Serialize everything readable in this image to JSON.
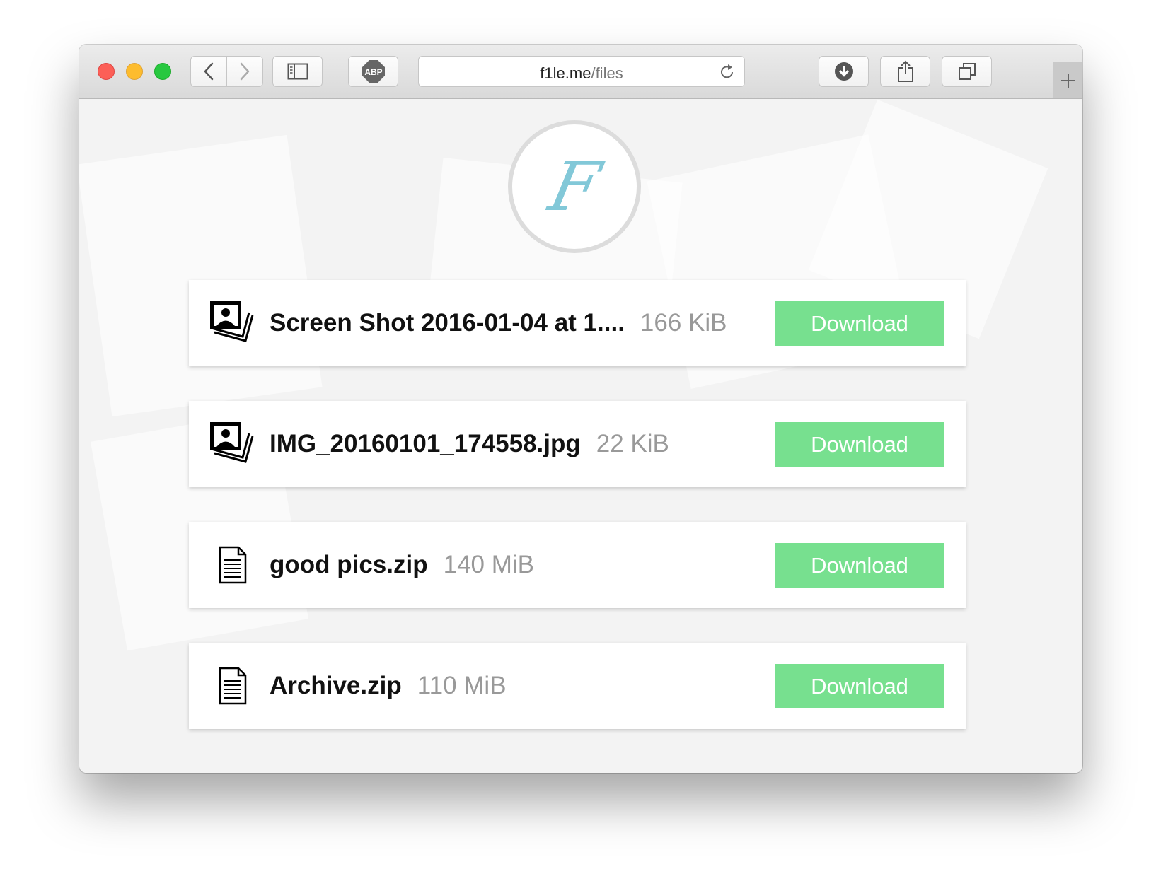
{
  "browser": {
    "url_host": "f1le.me",
    "url_path": "/files",
    "toolbar_icons": [
      "back-icon",
      "forward-icon",
      "sidebar-icon",
      "adblock-icon",
      "reload-icon",
      "downloads-icon",
      "share-icon",
      "tabs-icon",
      "new-tab-icon"
    ],
    "adblock_label": "ABP"
  },
  "logo": {
    "letter": "F",
    "color": "#82c8d8"
  },
  "files": [
    {
      "name": "Screen Shot 2016-01-04 at 1....",
      "size": "166 KiB",
      "icon": "image-stack-icon",
      "action": "Download"
    },
    {
      "name": "IMG_20160101_174558.jpg",
      "size": "22 KiB",
      "icon": "image-stack-icon",
      "action": "Download"
    },
    {
      "name": "good pics.zip",
      "size": "140 MiB",
      "icon": "document-icon",
      "action": "Download"
    },
    {
      "name": "Archive.zip",
      "size": "110 MiB",
      "icon": "document-icon",
      "action": "Download"
    }
  ],
  "colors": {
    "download_button": "#77e08f",
    "size_text": "#999999"
  }
}
